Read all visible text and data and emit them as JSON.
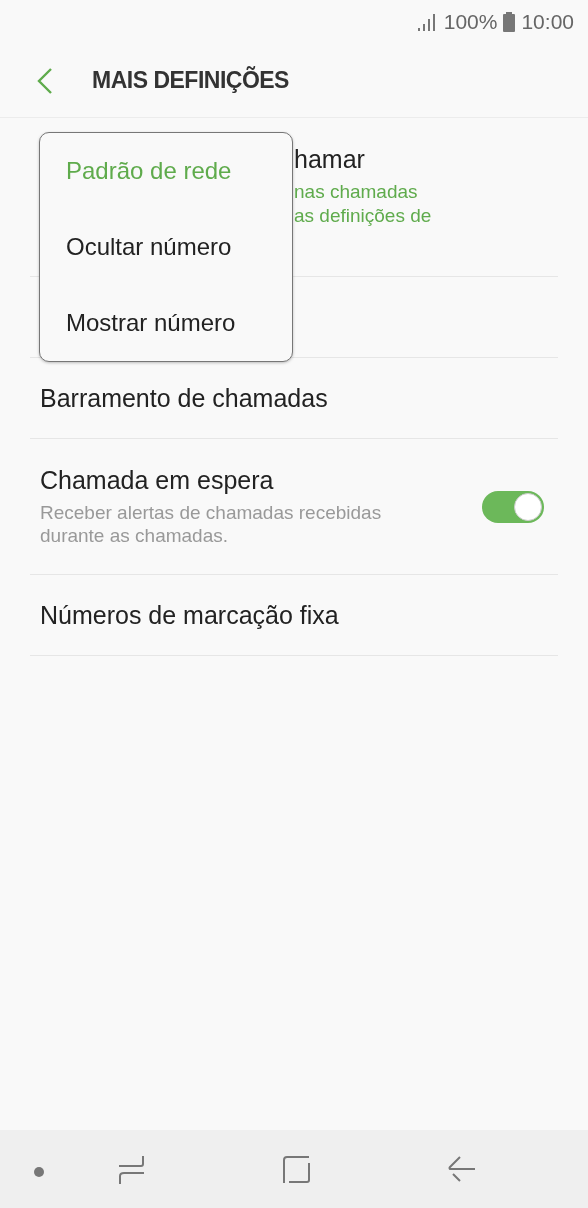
{
  "status_bar": {
    "battery": "100%",
    "time": "10:00"
  },
  "header": {
    "title": "MAIS DEFINIÇÕES"
  },
  "settings": [
    {
      "kind": "partial",
      "title": "hamar",
      "subtitle_lines": [
        "nas chamadas",
        "as definições de"
      ]
    },
    {
      "kind": "hidden"
    },
    {
      "kind": "plain",
      "title": "Barramento de chamadas"
    },
    {
      "kind": "toggle",
      "title": "Chamada em espera",
      "subtitle": "Receber alertas de chamadas recebidas durante as chamadas.",
      "on": true
    },
    {
      "kind": "plain",
      "title": "Números de marcação fixa"
    }
  ],
  "popup_menu": [
    {
      "label": "Padrão de rede",
      "selected": true
    },
    {
      "label": "Ocultar número",
      "selected": false
    },
    {
      "label": "Mostrar número",
      "selected": false
    }
  ]
}
